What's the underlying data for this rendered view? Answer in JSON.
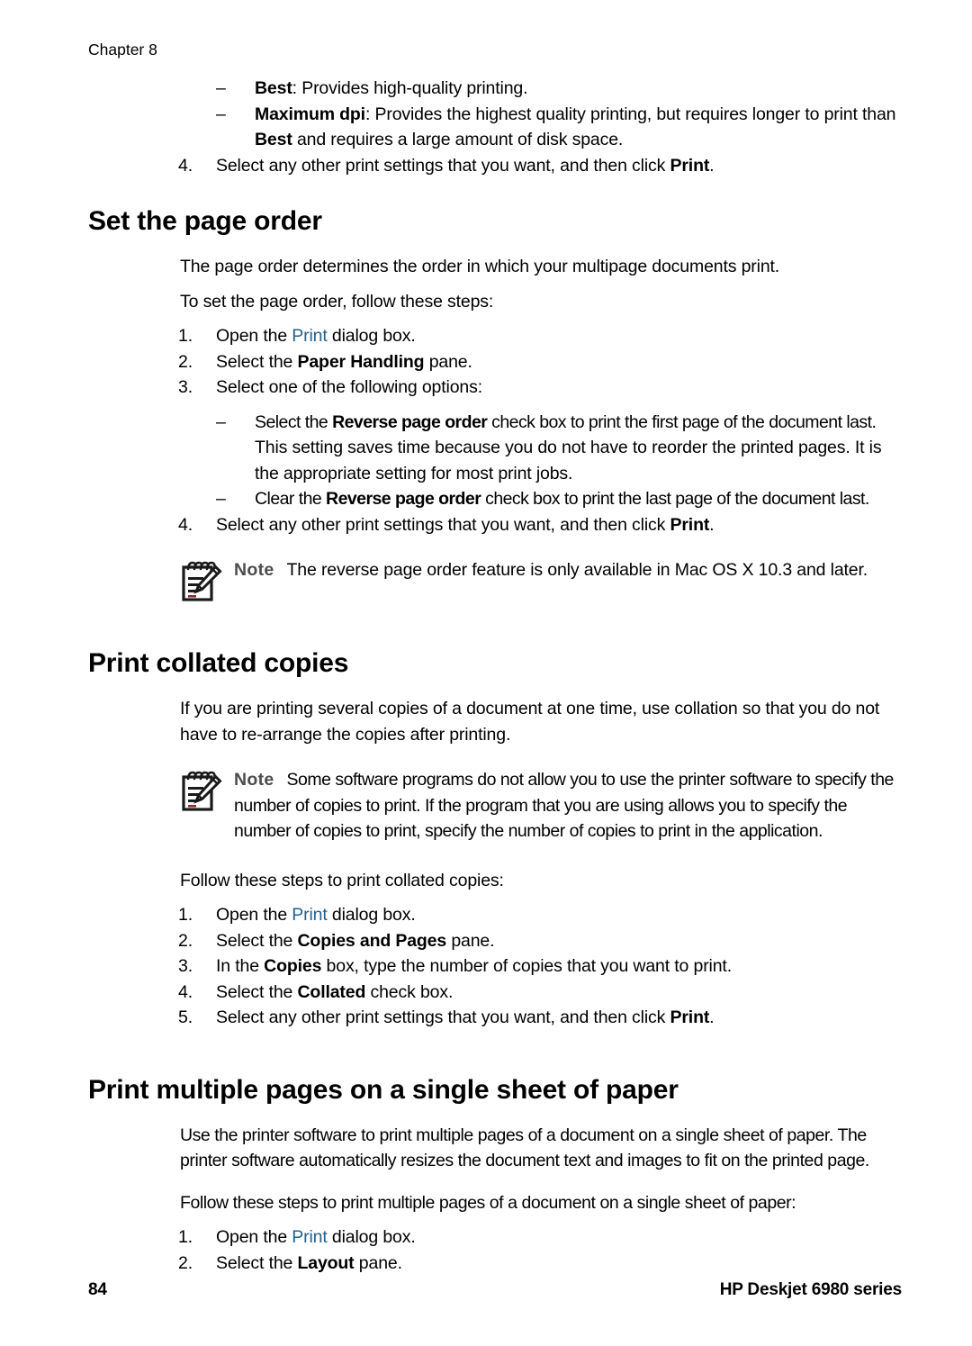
{
  "page": {
    "chapter_header": "Chapter 8",
    "page_number": "84",
    "product": "HP Deskjet 6980 series",
    "link_color": "#23608c",
    "note_label_color": "#4c4c4c"
  },
  "top_list": {
    "dash_marker": "–",
    "items": [
      {
        "bold": "Best",
        "rest": ": Provides high-quality printing."
      },
      {
        "bold": "Maximum dpi",
        "rest_a": ": Provides the highest quality printing, but requires longer to print than ",
        "bold_b": "Best",
        "rest_b": " and requires a large amount of disk space."
      }
    ],
    "step": {
      "marker": "4.",
      "pre": "Select any other print settings that you want, and then click ",
      "bold": "Print",
      "post": "."
    }
  },
  "section_page_order": {
    "heading": "Set the page order",
    "intro": "The page order determines the order in which your multipage documents print.",
    "lead_in": "To set the page order, follow these steps:",
    "steps": [
      {
        "marker": "1.",
        "pre": "Open the ",
        "link": "Print",
        "post": " dialog box."
      },
      {
        "marker": "2.",
        "pre": "Select the ",
        "bold": "Paper Handling",
        "post": " pane."
      },
      {
        "marker": "3.",
        "pre": "Select one of the following options:"
      }
    ],
    "sub_items": [
      {
        "marker": "–",
        "pre": "Select the ",
        "bold": "Reverse page order",
        "post": " check box to print the first page of the document last."
      },
      {
        "continuation": "This setting saves time because you do not have to reorder the printed pages. It is the appropriate setting for most print jobs."
      },
      {
        "marker": "–",
        "pre": "Clear the ",
        "bold": "Reverse page order",
        "post": " check box to print the last page of the document last."
      }
    ],
    "final_step": {
      "marker": "4.",
      "pre": "Select any other print settings that you want, and then click ",
      "bold": "Print",
      "post": "."
    },
    "note": {
      "icon": "notepad-pencil-icon",
      "label": "Note",
      "text": "The reverse page order feature is only available in Mac OS X 10.3 and later."
    }
  },
  "section_collated": {
    "heading": "Print collated copies",
    "intro": "If you are printing several copies of a document at one time, use collation so that you do not have to re-arrange the copies after printing.",
    "note": {
      "icon": "notepad-pencil-icon",
      "label": "Note",
      "text": "Some software programs do not allow you to use the printer software to specify the number of copies to print. If the program that you are using allows you to specify the number of copies to print, specify the number of copies to print in the application."
    },
    "lead_in": "Follow these steps to print collated copies:",
    "steps": [
      {
        "marker": "1.",
        "pre": "Open the ",
        "link": "Print",
        "post": " dialog box."
      },
      {
        "marker": "2.",
        "pre": "Select the ",
        "bold": "Copies and Pages",
        "post": " pane."
      },
      {
        "marker": "3.",
        "pre": "In the ",
        "bold": "Copies",
        "post": " box, type the number of copies that you want to print."
      },
      {
        "marker": "4.",
        "pre": "Select the ",
        "bold": "Collated",
        "post": " check box."
      },
      {
        "marker": "5.",
        "pre": "Select any other print settings that you want, and then click ",
        "bold": "Print",
        "post": "."
      }
    ]
  },
  "section_multiple_pages": {
    "heading": "Print multiple pages on a single sheet of paper",
    "intro": "Use the printer software to print multiple pages of a document on a single sheet of paper. The printer software automatically resizes the document text and images to fit on the printed page.",
    "lead_in": "Follow these steps to print multiple pages of a document on a single sheet of paper:",
    "steps": [
      {
        "marker": "1.",
        "pre": "Open the ",
        "link": "Print",
        "post": " dialog box."
      },
      {
        "marker": "2.",
        "pre": "Select the ",
        "bold": "Layout",
        "post": " pane."
      }
    ]
  }
}
